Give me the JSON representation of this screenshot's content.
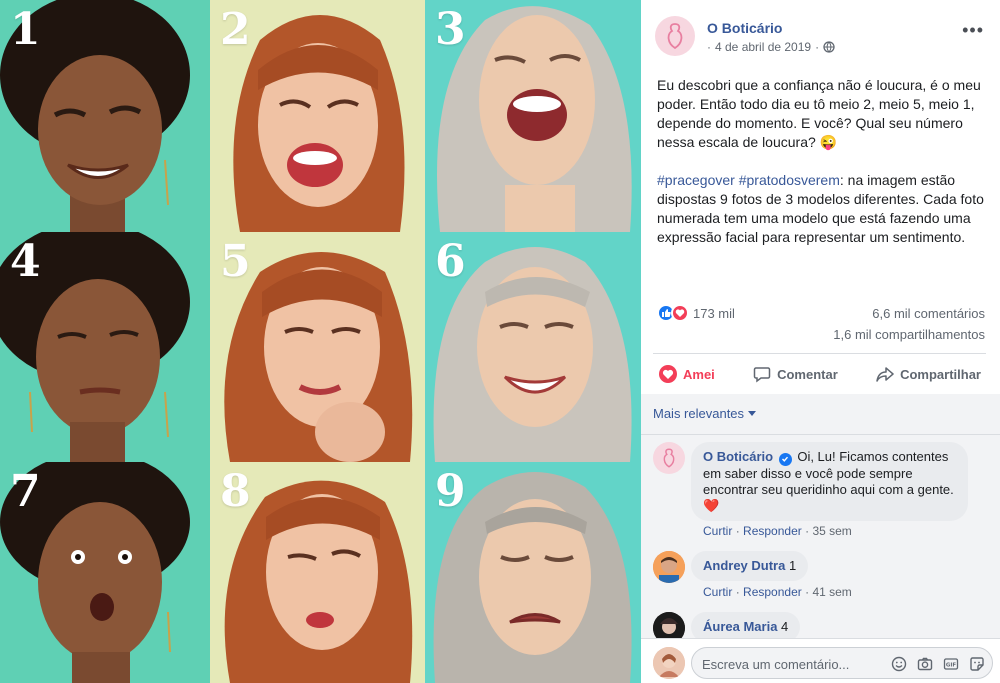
{
  "photos": {
    "numbers": [
      "1",
      "2",
      "3",
      "4",
      "5",
      "6",
      "7",
      "8",
      "9"
    ]
  },
  "post": {
    "page_name": "O Boticário",
    "date": "4 de abril de 2019",
    "dot": "·",
    "paragraph1": "Eu descobri que a confiança não é loucura, é o meu poder. Então todo dia eu tô meio 2, meio 5, meio 1, depende do momento. E você? Qual seu número nessa escala de loucura? 😜",
    "hashtag1": "#pracegover",
    "hashtag2": "#pratodosverem",
    "paragraph2": ": na imagem estão dispostas 9 fotos de 3 modelos diferentes. Cada foto numerada tem uma modelo que está fazendo uma expressão facial para representar um sentimento."
  },
  "stats": {
    "reactions": "173 mil",
    "comments": "6,6 mil comentários",
    "shares": "1,6 mil compartilhamentos"
  },
  "actions": {
    "love": "Amei",
    "comment": "Comentar",
    "share": "Compartilhar"
  },
  "comments": {
    "sort_label": "Mais relevantes",
    "items": [
      {
        "author": "O Boticário",
        "text": "Oi, Lu! Ficamos contentes em saber disso e você pode sempre encontrar seu queridinho aqui com a gente. ❤️",
        "reply": "Curtir",
        "respond": "Responder",
        "time": "35 sem"
      },
      {
        "author": "Andrey Dutra",
        "text": "1",
        "reply": "Curtir",
        "respond": "Responder",
        "time": "41 sem"
      },
      {
        "author": "Áurea Maria",
        "text": "4"
      }
    ],
    "separator": "·"
  },
  "composer": {
    "placeholder": "Escreva um comentário..."
  },
  "colors": {
    "teal": "#5fd0b4",
    "cream": "#e5e9b8",
    "aqua": "#62d4c8",
    "link": "#385898",
    "love": "#f33e58",
    "like": "#1877f2"
  },
  "icons": [
    "globe-icon",
    "like-icon",
    "love-icon",
    "comment-icon",
    "share-icon",
    "emoji-icon",
    "camera-icon",
    "gif-icon",
    "sticker-icon",
    "verified-icon",
    "caret-down-icon"
  ]
}
